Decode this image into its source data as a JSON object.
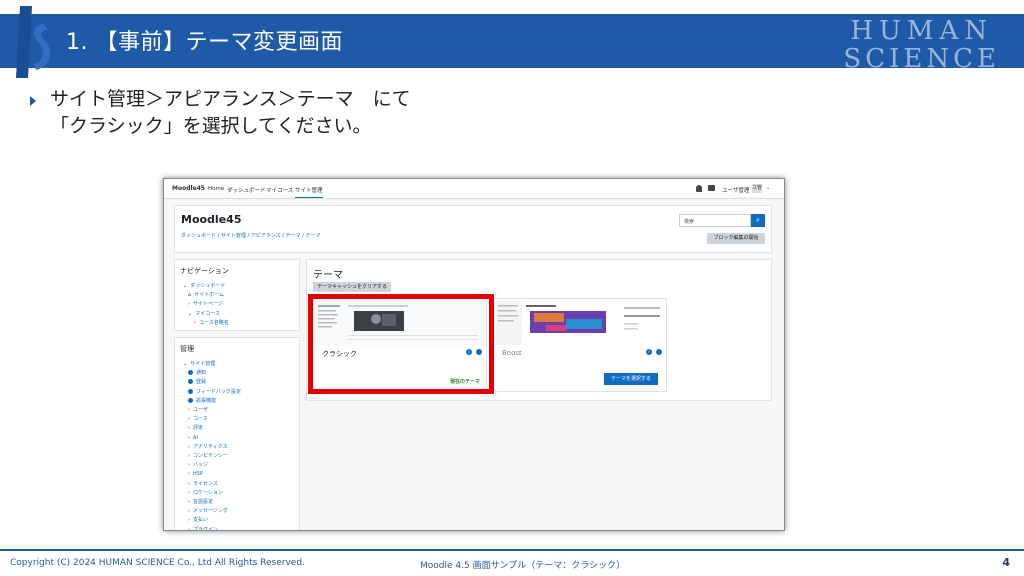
{
  "slide": {
    "title": "1. 【事前】テーマ変更画面",
    "brand": {
      "line1": "HUMAN",
      "line2": "SCIENCE"
    },
    "instruction": "サイト管理＞アピアランス＞テーマ　にて\n「クラシック」を選択してください。",
    "footer": {
      "copyright": "Copyright (C) 2024 HUMAN SCIENCE Co., Ltd All Rights Reserved.",
      "caption": "Moodle 4.5 画面サンプル（テーマ：クラシック）",
      "page": "4"
    },
    "colors": {
      "band": "#1f5aa8",
      "highlight": "#e40000",
      "moodle_blue": "#0f6cbf"
    }
  },
  "moodle": {
    "nav": {
      "brand": "Moodle45",
      "items": [
        "Home",
        "ダッシュボード",
        "マイコース",
        "サイト管理"
      ],
      "active_item": "サイト管理",
      "user_menu": "ユーザ管理",
      "avatar": "ユ管",
      "icons": [
        "bell-icon",
        "chat-icon"
      ]
    },
    "header": {
      "site_name": "Moodle45",
      "breadcrumb": "ダッシュボード / サイト管理 / アピアランス / テーマ / テーマ",
      "search_placeholder": "検索",
      "edit_button": "ブロック編集の開始"
    },
    "nav_block": {
      "title": "ナビゲーション",
      "items": [
        {
          "label": "ダッシュボード",
          "level": 1,
          "marker": "v"
        },
        {
          "label": "サイトホーム",
          "level": 2,
          "marker": "home"
        },
        {
          "label": "サイトページ",
          "level": 2,
          "marker": ">"
        },
        {
          "label": "マイコース",
          "level": 2,
          "marker": "v"
        },
        {
          "label": "コース名略名",
          "level": 3,
          "marker": ">"
        }
      ]
    },
    "admin_block": {
      "title": "管理",
      "items": [
        {
          "label": "サイト管理",
          "level": 1,
          "marker": "v"
        },
        {
          "label": "通知",
          "level": 2,
          "marker": "gear"
        },
        {
          "label": "登録",
          "level": 2,
          "marker": "gear"
        },
        {
          "label": "フィードバック設定",
          "level": 2,
          "marker": "gear"
        },
        {
          "label": "拡張機能",
          "level": 2,
          "marker": "gear"
        },
        {
          "label": "ユーザ",
          "level": 2,
          "marker": ">"
        },
        {
          "label": "コース",
          "level": 2,
          "marker": ">"
        },
        {
          "label": "評定",
          "level": 2,
          "marker": ">"
        },
        {
          "label": "AI",
          "level": 2,
          "marker": ">"
        },
        {
          "label": "アナリティクス",
          "level": 2,
          "marker": ">"
        },
        {
          "label": "コンピテンシー",
          "level": 2,
          "marker": ">"
        },
        {
          "label": "バッジ",
          "level": 2,
          "marker": ">"
        },
        {
          "label": "H5P",
          "level": 2,
          "marker": ">"
        },
        {
          "label": "ライセンス",
          "level": 2,
          "marker": ">"
        },
        {
          "label": "ロケーション",
          "level": 2,
          "marker": ">"
        },
        {
          "label": "言語設定",
          "level": 2,
          "marker": ">"
        },
        {
          "label": "メッセージング",
          "level": 2,
          "marker": ">"
        },
        {
          "label": "支払い",
          "level": 2,
          "marker": ">"
        },
        {
          "label": "プラグイン",
          "level": 2,
          "marker": ">"
        }
      ]
    },
    "main": {
      "title": "テーマ",
      "clear_cache_button": "テーマキャッシュをクリアする",
      "themes": [
        {
          "name": "クラシック",
          "status": "現在のテーマ"
        },
        {
          "name": "Boost",
          "action": "テーマを選択する"
        }
      ]
    }
  }
}
